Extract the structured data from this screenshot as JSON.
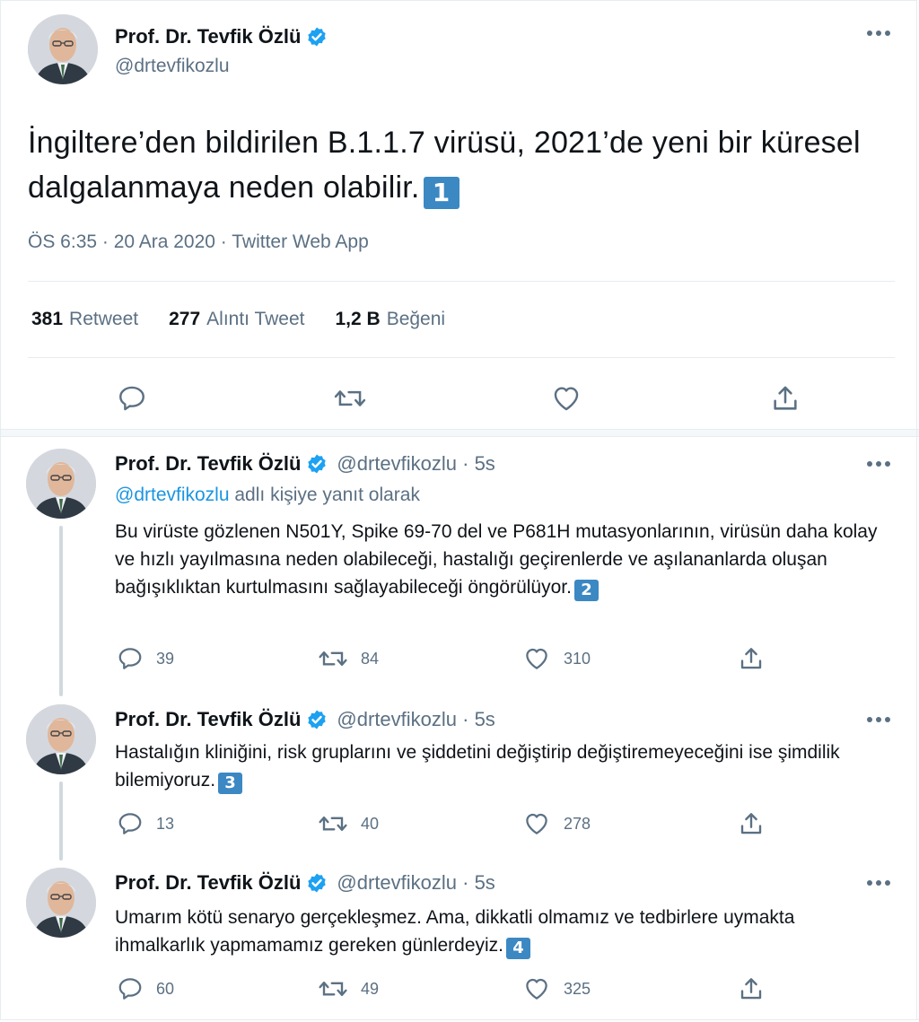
{
  "main_tweet": {
    "display_name": "Prof. Dr. Tevfik Özlü",
    "handle": "@drtevfikozlu",
    "text": "İngiltere’den bildirilen B.1.1.7 virüsü, 2021’de yeni bir küresel dalgalanmaya neden olabilir.",
    "keycap": "1",
    "meta": "ÖS 6:35 · 20 Ara 2020 · Twitter Web App",
    "stats": {
      "retweets_num": "381",
      "retweets_label": "Retweet",
      "quotes_num": "277",
      "quotes_label": "Alıntı Tweet",
      "likes_num": "1,2 B",
      "likes_label": "Beğeni"
    },
    "icons": {
      "more": "more-dots-icon",
      "verified": "verified-badge-icon",
      "reply": "reply-icon",
      "retweet": "retweet-icon",
      "like": "heart-icon",
      "share": "share-icon"
    }
  },
  "replies": [
    {
      "display_name": "Prof. Dr. Tevfik Özlü",
      "handle_time": "@drtevfikozlu · 5s",
      "reply_to_mention": "@drtevfikozlu",
      "reply_to_suffix": "adlı kişiye yanıt olarak",
      "text": "Bu virüste gözlenen N501Y, Spike 69-70 del ve P681H mutasyonlarının, virüsün daha kolay ve hızlı yayılmasına neden olabileceği, hastalığı geçirenlerde ve aşılananlarda oluşan bağışıklıktan kurtulmasını sağlayabileceği öngörülüyor.",
      "keycap": "2",
      "replies": "39",
      "retweets": "84",
      "likes": "310"
    },
    {
      "display_name": "Prof. Dr. Tevfik Özlü",
      "handle_time": "@drtevfikozlu · 5s",
      "text": "Hastalığın kliniğini, risk gruplarını ve şiddetini değiştirip değiştiremeyeceğini ise şimdilik bilemiyoruz.",
      "keycap": "3",
      "replies": "13",
      "retweets": "40",
      "likes": "278"
    },
    {
      "display_name": "Prof. Dr. Tevfik Özlü",
      "handle_time": "@drtevfikozlu · 5s",
      "text": "Umarım kötü senaryo gerçekleşmez. Ama, dikkatli olmamız ve tedbirlere uymakta ihmalkarlık yapmamamız gereken günlerdeyiz.",
      "keycap": "4",
      "replies": "60",
      "retweets": "49",
      "likes": "325"
    }
  ],
  "colors": {
    "text_primary": "#0f1419",
    "text_secondary": "#5b7083",
    "link": "#1b95e0",
    "verified": "#1da1f2",
    "keycap": "#3b88c3",
    "border": "#e6ecf0",
    "thread_line": "#cfd9de"
  }
}
